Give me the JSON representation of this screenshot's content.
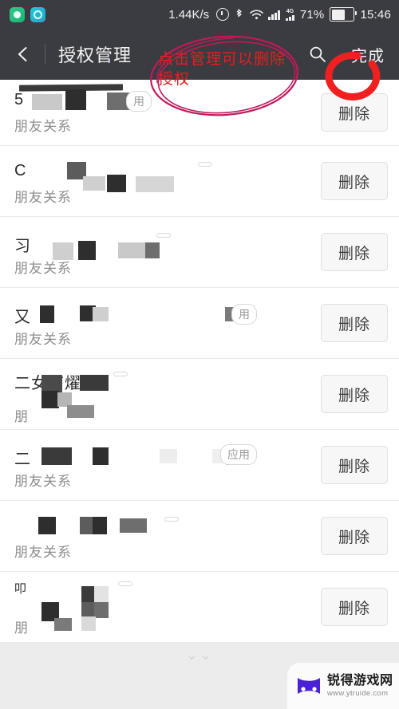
{
  "status_bar": {
    "network_speed": "1.44K/s",
    "battery_percent": "71%",
    "time": "15:46",
    "network_type": "4G",
    "icons": [
      "notification-green-icon",
      "notification-cyan-icon",
      "alarm-icon",
      "bluetooth-icon",
      "wifi-icon",
      "signal-icon",
      "signal-4g-icon",
      "battery-icon"
    ]
  },
  "toolbar": {
    "back_icon": "back-arrow-icon",
    "title": "授权管理",
    "search_icon": "search-icon",
    "done_label": "完成"
  },
  "annotation": {
    "text": "点击管理可以删除授权",
    "color": "#e02020",
    "shape": "ellipse",
    "circled_target": "完成"
  },
  "list": {
    "rows": [
      {
        "name": "5",
        "subtitle": "朋友关系",
        "tag": "用",
        "delete_label": "删除",
        "redacted": true
      },
      {
        "name": "C",
        "subtitle": "朋友关系",
        "tag": "",
        "delete_label": "删除",
        "redacted": true
      },
      {
        "name": "习",
        "subtitle": "朋友关系",
        "tag": "",
        "delete_label": "删除",
        "redacted": true
      },
      {
        "name": "又",
        "subtitle": "朋友关系",
        "tag": "用",
        "delete_label": "删除",
        "redacted": true
      },
      {
        "name": "二女节燿",
        "subtitle": "朋",
        "tag": "",
        "delete_label": "删除",
        "redacted": true
      },
      {
        "name": "二",
        "subtitle": "朋友关系",
        "tag": "应用",
        "delete_label": "删除",
        "redacted": true
      },
      {
        "name": "",
        "subtitle": "朋友关系",
        "tag": "",
        "delete_label": "删除",
        "redacted": true
      },
      {
        "name": "叩",
        "subtitle": "朋",
        "tag": "",
        "delete_label": "删除",
        "redacted": true
      }
    ]
  },
  "footer": {
    "nav_hint": "",
    "watermark_name": "锐得游戏网",
    "watermark_url": "www.ytruide.com",
    "watermark_color": "#4b21d6"
  }
}
